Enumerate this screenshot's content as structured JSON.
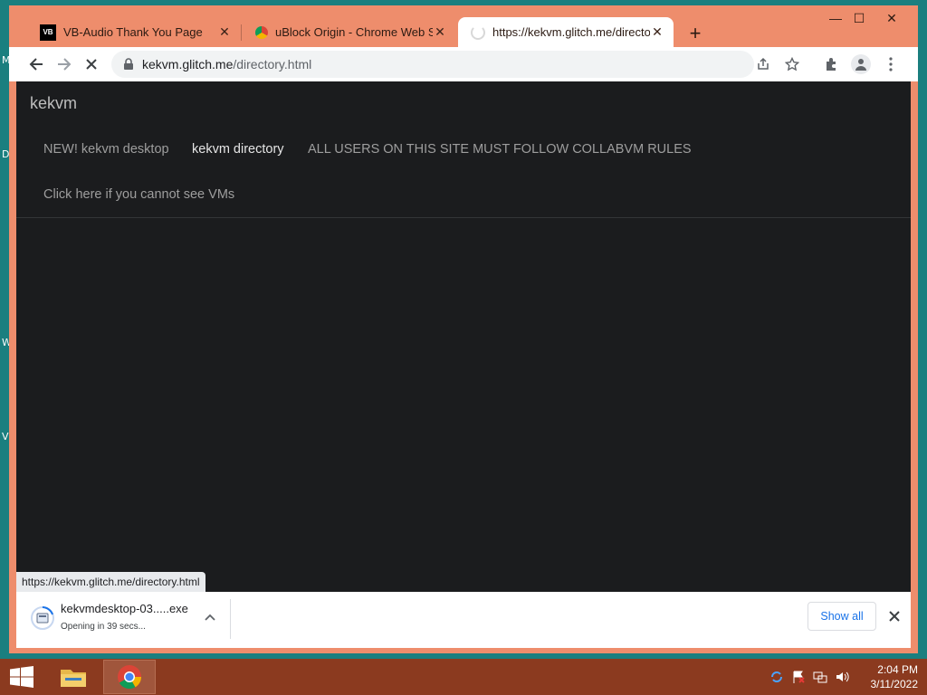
{
  "desktop": {
    "side_letters": [
      "M",
      "D",
      "W",
      "V"
    ]
  },
  "browser": {
    "tabs": [
      {
        "title": "VB-Audio Thank You Page",
        "favicon": "vb-audio-icon",
        "favicon_text": "VB"
      },
      {
        "title": "uBlock Origin - Chrome Web Sto",
        "favicon": "chrome-web-store-icon"
      },
      {
        "title": "https://kekvm.glitch.me/directory",
        "favicon": "loading-icon",
        "active": true
      }
    ],
    "new_tab": "+",
    "window_controls": {
      "minimize": "—",
      "maximize": "☐",
      "close": "✕"
    },
    "address": {
      "host": "kekvm.glitch.me",
      "path": "/directory.html"
    },
    "status_url": "https://kekvm.glitch.me/directory.html"
  },
  "page": {
    "brand": "kekvm",
    "nav": [
      {
        "label": "NEW! kekvm desktop",
        "active": false
      },
      {
        "label": "kekvm directory",
        "active": true
      },
      {
        "label": "ALL USERS ON THIS SITE MUST FOLLOW COLLABVM RULES",
        "active": false
      }
    ],
    "link": "Click here if you cannot see VMs"
  },
  "download": {
    "filename": "kekvmdesktop-03.....exe",
    "status": "Opening in 39 secs...",
    "show_all": "Show all"
  },
  "taskbar": {
    "time": "2:04 PM",
    "date": "3/11/2022"
  },
  "colors": {
    "window_frame": "#ee8d6c",
    "page_bg": "#1b1c1e",
    "taskbar": "#8b3a1f",
    "link_blue": "#1a73e8"
  }
}
